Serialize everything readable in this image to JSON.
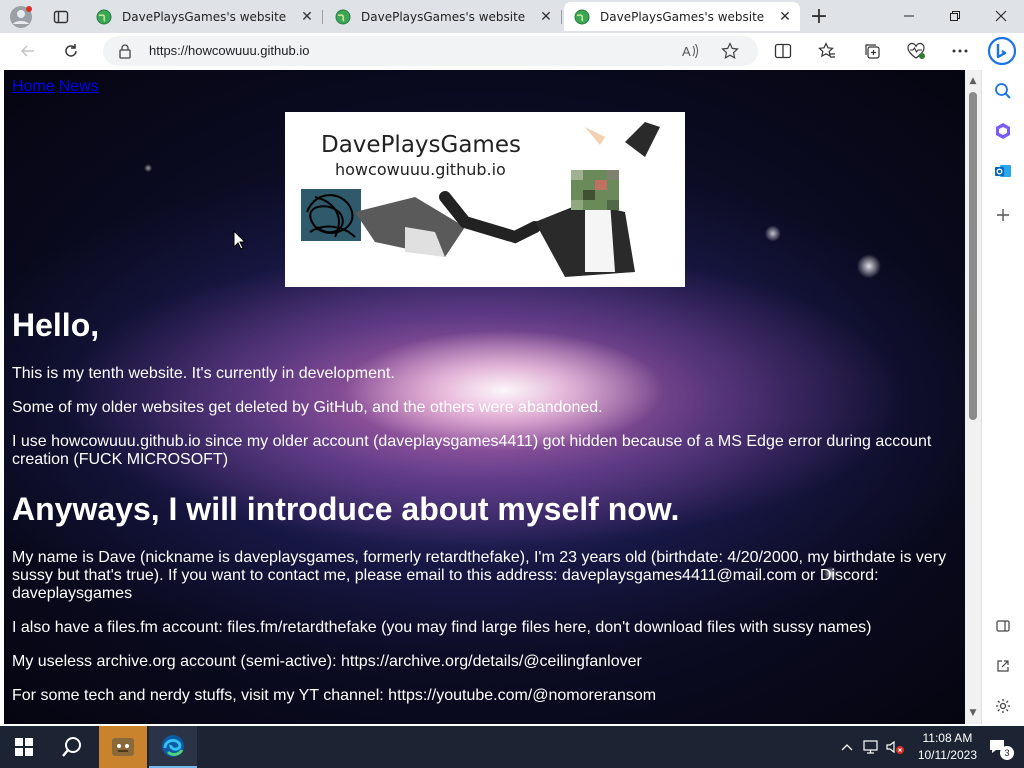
{
  "browser": {
    "tabs": [
      {
        "title": "DavePlaysGames's website",
        "active": false
      },
      {
        "title": "DavePlaysGames's website",
        "active": false
      },
      {
        "title": "DavePlaysGames's website",
        "active": true
      }
    ],
    "new_tab_glyph": "+",
    "close_glyph": "✕",
    "address": {
      "url": "https://howcowuuu.github.io"
    }
  },
  "page": {
    "nav": {
      "home": "Home",
      "news": "News"
    },
    "banner": {
      "title": "DavePlaysGames",
      "subtitle": "howcowuuu.github.io"
    },
    "heading_hello": "Hello,",
    "intro_paragraphs": [
      "This is my tenth website. It's currently in development.",
      "Some of my older websites get deleted by GitHub, and the others were abandoned.",
      "I use howcowuuu.github.io since my older account (daveplaysgames4411) got hidden because of a MS Edge error during account creation (FUCK MICROSOFT)"
    ],
    "heading_intro": "Anyways, I will introduce about myself now.",
    "about_paragraphs": [
      "My name is Dave (nickname is daveplaysgames, formerly retardthefake), I'm 23 years old (birthdate: 4/20/2000, my birthdate is very sussy but that's true). If you want to contact me, please email to this address: daveplaysgames4411@mail.com or Discord: daveplaysgames",
      "I also have a files.fm account: files.fm/retardthefake (you may find large files here, don't download files with sussy names)",
      "My useless archive.org account (semi-active): https://archive.org/details/@ceilingfanlover",
      "For some tech and nerdy stuffs, visit my YT channel: https://youtube.com/@nomoreransom"
    ]
  },
  "taskbar": {
    "time": "11:08 AM",
    "date": "10/11/2023",
    "notification_count": "3"
  },
  "colors": {
    "link": "#0000ee",
    "taskbar": "#1c2333",
    "tabstrip": "#dfe3e8",
    "edge_blue": "#0c59a4"
  }
}
